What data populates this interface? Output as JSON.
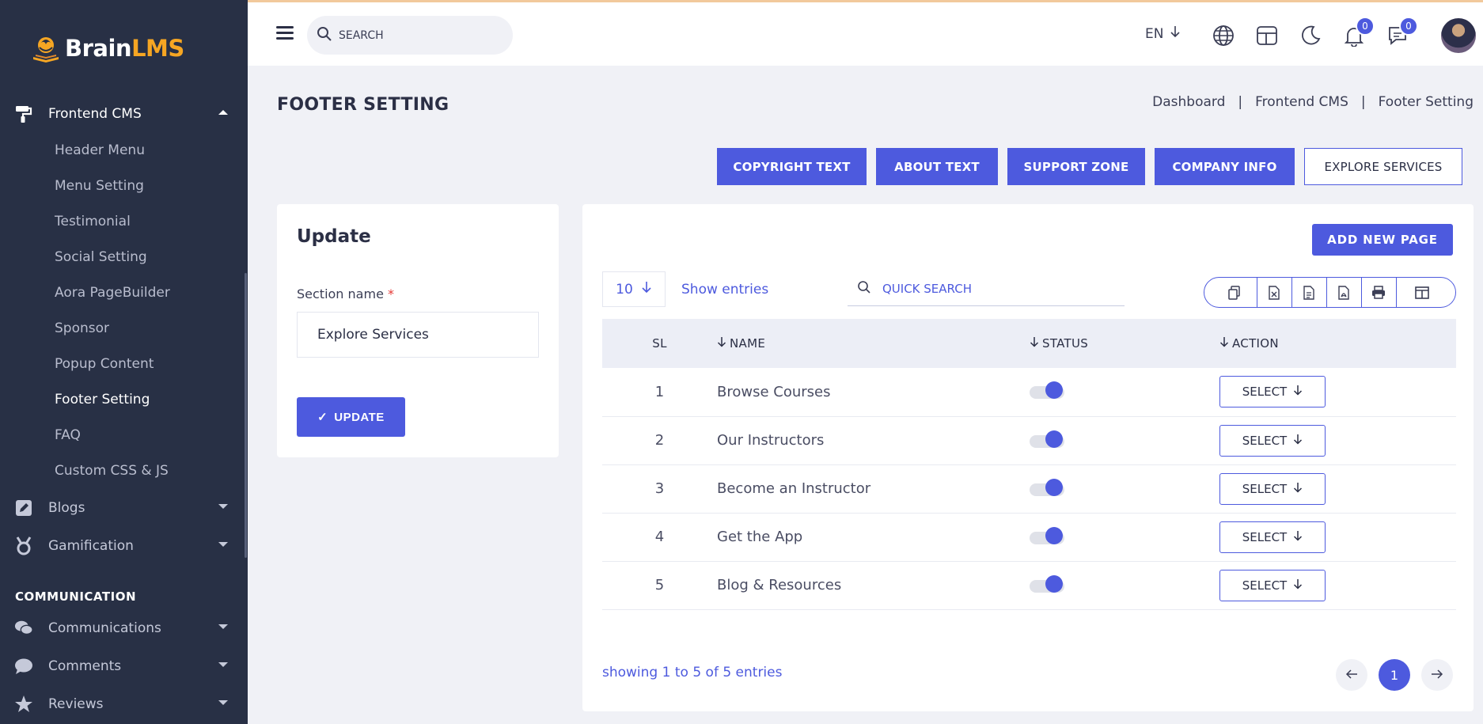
{
  "sidebar": {
    "logo": {
      "word": "Brain",
      "accent": "LMS"
    },
    "frontend_cms": {
      "label": "Frontend CMS",
      "items": [
        "Header Menu",
        "Menu Setting",
        "Testimonial",
        "Social Setting",
        "Aora PageBuilder",
        "Sponsor",
        "Popup Content",
        "Footer Setting",
        "FAQ",
        "Custom CSS & JS"
      ],
      "current": "Footer Setting"
    },
    "groups": [
      {
        "label": "Blogs",
        "icon": "edit-icon"
      },
      {
        "label": "Gamification",
        "icon": "medal-icon"
      }
    ],
    "section_title": "COMMUNICATION",
    "communication": [
      {
        "label": "Communications",
        "icon": "chat-icon"
      },
      {
        "label": "Comments",
        "icon": "comment-icon"
      },
      {
        "label": "Reviews",
        "icon": "star-icon"
      }
    ]
  },
  "topbar": {
    "search_placeholder": "SEARCH",
    "language": "EN",
    "notifications_count": "0",
    "messages_count": "0"
  },
  "page": {
    "title": "FOOTER SETTING",
    "breadcrumb": [
      "Dashboard",
      "Frontend CMS",
      "Footer Setting"
    ],
    "breadcrumb_sep": "|"
  },
  "tabs": [
    {
      "label": "COPYRIGHT TEXT",
      "active": false
    },
    {
      "label": "ABOUT TEXT",
      "active": false
    },
    {
      "label": "SUPPORT ZONE",
      "active": false
    },
    {
      "label": "COMPANY INFO",
      "active": false
    },
    {
      "label": "EXPLORE SERVICES",
      "active": true
    }
  ],
  "update_form": {
    "heading": "Update",
    "section_label": "Section name",
    "required_mark": "*",
    "section_value": "Explore Services",
    "submit_label": "UPDATE",
    "submit_check": "✓"
  },
  "table_panel": {
    "add_button": "ADD NEW PAGE",
    "entries_value": "10",
    "entries_label": "Show entries",
    "quick_search_placeholder": "QUICK SEARCH",
    "columns": {
      "sl": "SL",
      "name": "NAME",
      "status": "STATUS",
      "action": "ACTION"
    },
    "rows": [
      {
        "sl": "1",
        "name": "Browse Courses",
        "status": true,
        "action": "SELECT"
      },
      {
        "sl": "2",
        "name": "Our Instructors",
        "status": true,
        "action": "SELECT"
      },
      {
        "sl": "3",
        "name": "Become an Instructor",
        "status": true,
        "action": "SELECT"
      },
      {
        "sl": "4",
        "name": "Get the App",
        "status": true,
        "action": "SELECT"
      },
      {
        "sl": "5",
        "name": "Blog & Resources",
        "status": true,
        "action": "SELECT"
      }
    ],
    "showing_text": "showing 1 to 5 of 5 entries",
    "current_page": "1"
  },
  "colors": {
    "primary": "#4d5ade",
    "sidebar_bg": "#283045",
    "logo_accent": "#f6a623"
  }
}
